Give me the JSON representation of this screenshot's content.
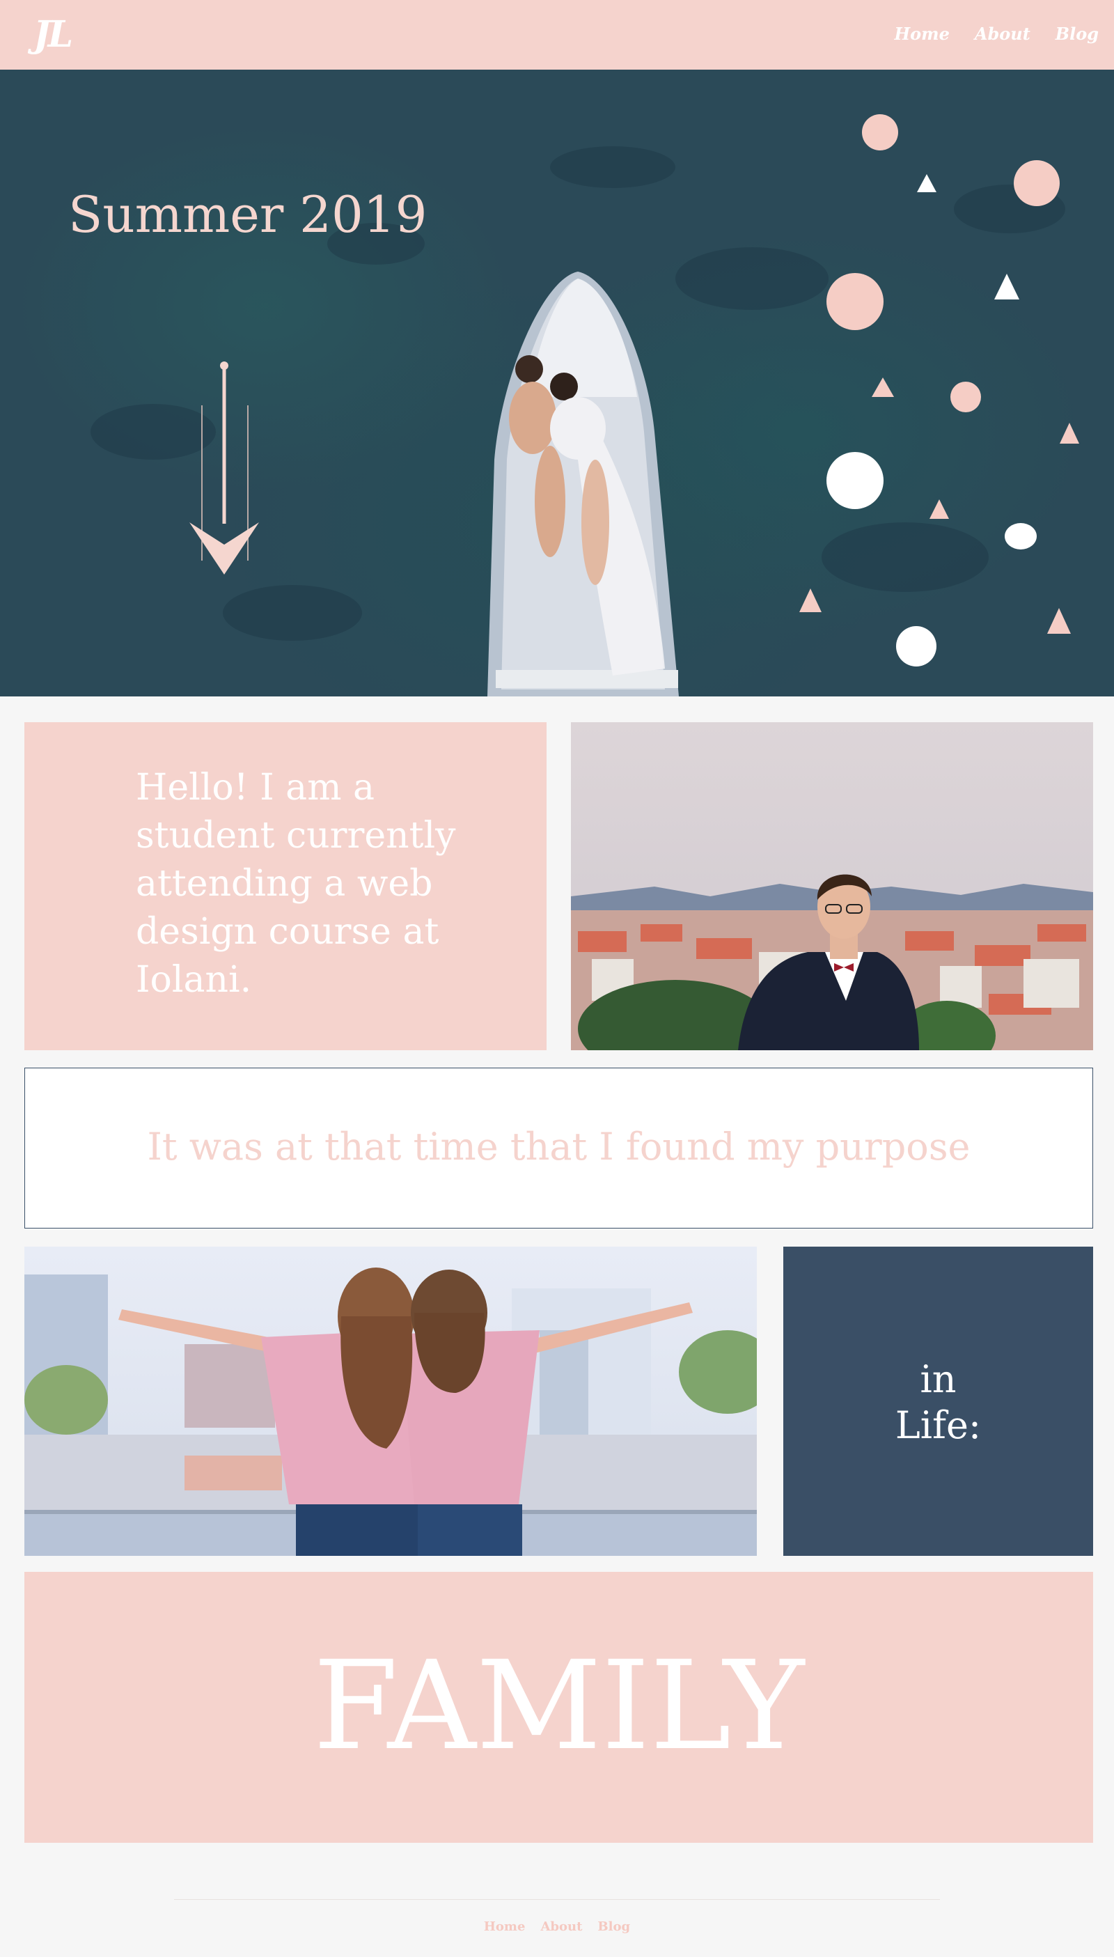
{
  "header": {
    "logo": "JL",
    "nav": [
      {
        "label": "Home"
      },
      {
        "label": "About"
      },
      {
        "label": "Blog"
      }
    ]
  },
  "hero": {
    "title": "Summer 2019",
    "scroll_icon": "arrow-down-icon"
  },
  "intro": {
    "text": "Hello! I am a student currently attending a web design course at Iolani."
  },
  "quote": {
    "text": "It was at that time that I found my purpose"
  },
  "life": {
    "line1": "in",
    "line2": "Life:"
  },
  "family": {
    "text": "FAMILY"
  },
  "footer": {
    "nav": [
      {
        "label": "Home"
      },
      {
        "label": "About"
      },
      {
        "label": "Blog"
      }
    ]
  },
  "colors": {
    "accent_pink": "#f5d3cd",
    "navy": "#3a4f66",
    "hero_teal": "#2b4a58",
    "background": "#f6f6f6"
  }
}
